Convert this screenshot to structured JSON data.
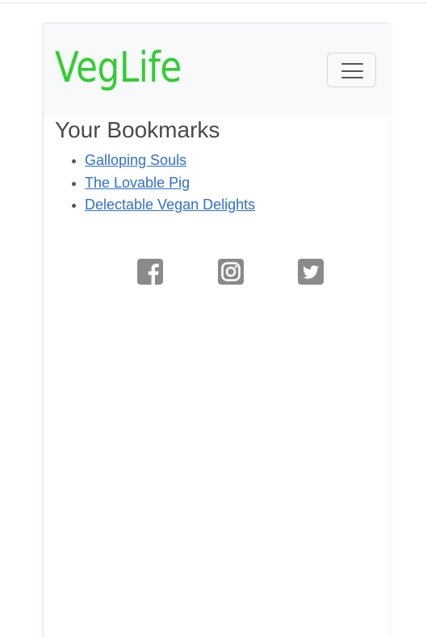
{
  "brand": {
    "name": "VegLife",
    "color": "#32cd32"
  },
  "navbar": {
    "toggle_icon": "hamburger-menu-icon"
  },
  "main": {
    "heading": "Your Bookmarks",
    "bookmarks": [
      {
        "label": "Galloping Souls"
      },
      {
        "label": "The Lovable Pig"
      },
      {
        "label": "Delectable Vegan Delights"
      }
    ],
    "link_color": "#2f6fd6"
  },
  "social": {
    "icons": [
      "facebook-icon",
      "instagram-icon",
      "twitter-icon"
    ],
    "icon_color": "#8a8a8a"
  }
}
